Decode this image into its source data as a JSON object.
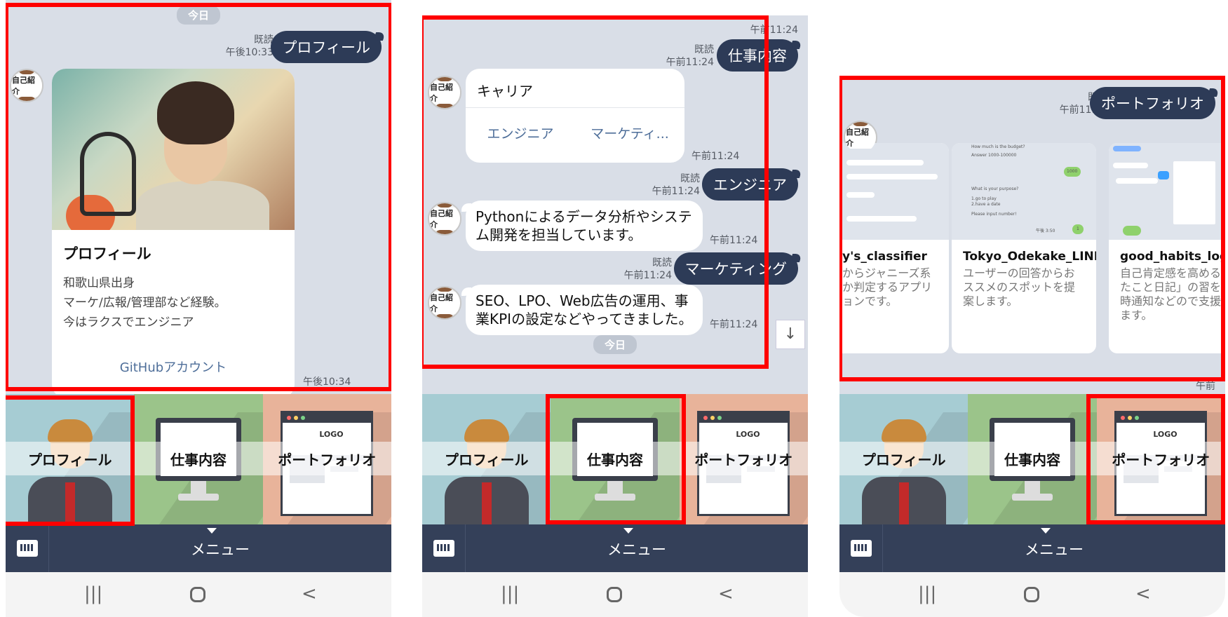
{
  "colors": {
    "highlight": "#ff0000",
    "chat_bg": "#d9dee7",
    "bubble_out": "#2d3b57",
    "menu_bar": "#344059",
    "link": "#4e6e99"
  },
  "common": {
    "avatar_label": "自己紹介",
    "read_label": "既読",
    "rich_menu": {
      "profile": "プロフィール",
      "work": "仕事内容",
      "portfolio": "ポートフォリオ",
      "portfolio_logo": "LOGO"
    },
    "menu_label": "メニュー",
    "nav_icons": [
      "recent-apps-icon",
      "home-icon",
      "back-icon"
    ]
  },
  "screen1": {
    "date": "今日",
    "sent": {
      "text": "プロフィール",
      "time": "午後10:33"
    },
    "card": {
      "title": "プロフィール",
      "lines": [
        "和歌山県出身",
        "マーケ/広報/管理部など経験。",
        "今はラクスでエンジニア"
      ],
      "link": "GitHubアカウント"
    },
    "card_time": "午後10:34"
  },
  "screen2": {
    "top_time": "午前11:24",
    "sent1": {
      "text": "仕事内容",
      "time": "午前11:24"
    },
    "career": {
      "title": "キャリア",
      "options": [
        "エンジニア",
        "マーケティ..."
      ],
      "time": "午前11:24"
    },
    "sent2": {
      "text": "エンジニア",
      "time": "午前11:24"
    },
    "reply1": {
      "text": "Pythonによるデータ分析やシステム開発を担当しています。",
      "time": "午前11:24"
    },
    "sent3": {
      "text": "マーケティング",
      "time": "午前11:24"
    },
    "reply2": {
      "text": "SEO、LPO、Web広告の運用、事業KPIの設定などやってきました。",
      "time": "午前11:24"
    },
    "date": "今日"
  },
  "screen3": {
    "sent": {
      "text": "ポートフォリオ",
      "time": "午前11:24"
    },
    "cards": [
      {
        "title": "y's_classifier",
        "desc": "からジャニーズ系か判定するアプリョンです。"
      },
      {
        "title": "Tokyo_Odekake_LINE",
        "desc": "ユーザーの回答からおススメのスポットを提案します。"
      },
      {
        "title": "good_habits_logg",
        "desc": "自己肯定感を高めるきたこと日記」の習を定時通知などので支援します。"
      }
    ],
    "thumb_texts": {
      "budget_q": "How much is the budget?",
      "budget_a": "Answer 1000-100000",
      "budget_val": "1000",
      "purpose_q": "What is your purpose?",
      "purpose_opt1": "1.go to play",
      "purpose_opt2": "2.have a date",
      "input_prompt": "Please input number!",
      "input_val": "1",
      "thumb_time": "午後 3:50"
    },
    "bottom_time": "午前"
  }
}
